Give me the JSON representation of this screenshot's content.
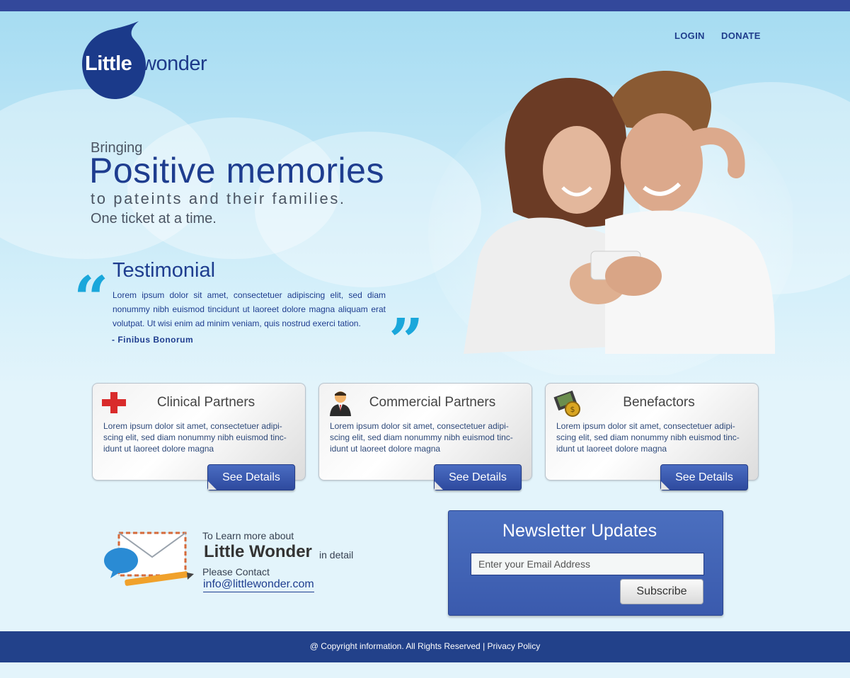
{
  "brand": {
    "logo_part1": "Little",
    "logo_part2": "wonder",
    "colors": {
      "primary": "#1e3d8f",
      "accent": "#1aa7db",
      "bar": "#33489b"
    }
  },
  "nav": {
    "login": "LOGIN",
    "donate": "DONATE"
  },
  "hero": {
    "kicker": "Bringing",
    "headline": "Positive memories",
    "line2": "to pateints and their families.",
    "line3": "One ticket at a time."
  },
  "testimonial": {
    "title": "Testimonial",
    "body": "Lorem ipsum dolor sit amet, consectetuer adipiscing elit, sed diam nonummy nibh euismod tincidunt ut laoreet dolore magna aliquam erat volutpat. Ut wisi enim ad minim veniam, quis nostrud exerci tation.",
    "author": "- Finibus Bonorum",
    "open_quote": "“",
    "close_quote": "”"
  },
  "cards": [
    {
      "title": "Clinical Partners",
      "body": "Lorem ipsum dolor sit amet, consectetuer adipi-scing elit, sed diam nonummy nibh euismod tinc-idunt ut laoreet dolore magna",
      "button": "See Details",
      "icon": "red-cross-icon"
    },
    {
      "title": "Commercial Partners",
      "body": "Lorem ipsum dolor sit amet, consectetuer adipi-scing elit, sed diam nonummy nibh euismod tinc-idunt ut laoreet dolore magna",
      "button": "See Details",
      "icon": "businessman-icon"
    },
    {
      "title": "Benefactors",
      "body": "Lorem ipsum dolor sit amet, consectetuer adipi-scing elit, sed diam nonummy nibh euismod tinc-idunt ut laoreet dolore magna",
      "button": "See Details",
      "icon": "money-icon"
    }
  ],
  "contact": {
    "learn": "To Learn more about",
    "name": "Little Wonder",
    "in_detail": "in detail",
    "please": "Please Contact",
    "email": "info@littlewonder.com"
  },
  "newsletter": {
    "title": "Newsletter Updates",
    "placeholder": "Enter your Email Address",
    "button": "Subscribe"
  },
  "footer": {
    "copyright": "@ Copyright information.  All Rights Reserved",
    "separator": " | ",
    "privacy": "Privacy Policy"
  }
}
